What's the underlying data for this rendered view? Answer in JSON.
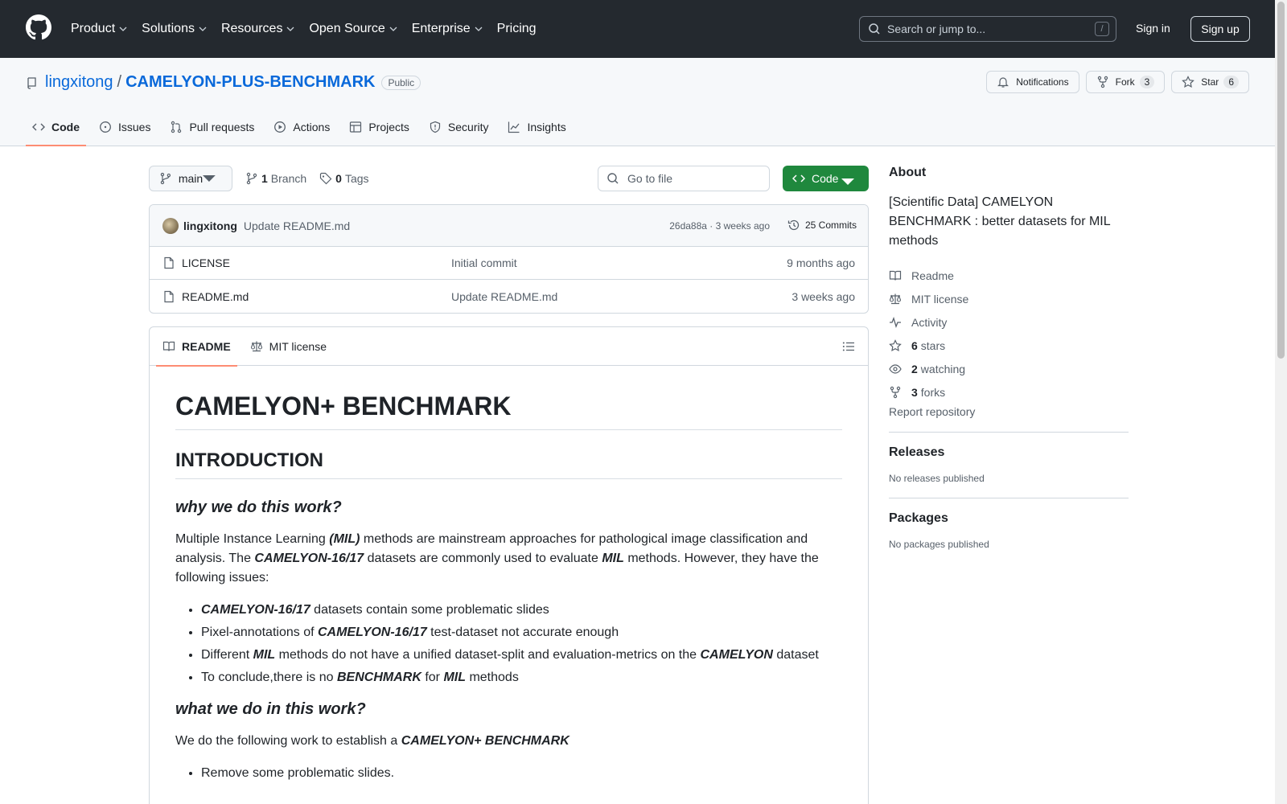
{
  "header": {
    "nav": [
      {
        "label": "Product",
        "dropdown": true
      },
      {
        "label": "Solutions",
        "dropdown": true
      },
      {
        "label": "Resources",
        "dropdown": true
      },
      {
        "label": "Open Source",
        "dropdown": true
      },
      {
        "label": "Enterprise",
        "dropdown": true
      },
      {
        "label": "Pricing",
        "dropdown": false
      }
    ],
    "search_placeholder": "Search or jump to...",
    "search_shortcut": "/",
    "sign_in": "Sign in",
    "sign_up": "Sign up"
  },
  "repo": {
    "owner": "lingxitong",
    "separator": "/",
    "name": "CAMELYON-PLUS-BENCHMARK",
    "visibility": "Public",
    "notifications_label": "Notifications",
    "fork_label": "Fork",
    "fork_count": "3",
    "star_label": "Star",
    "star_count": "6",
    "tabs": [
      "Code",
      "Issues",
      "Pull requests",
      "Actions",
      "Projects",
      "Security",
      "Insights"
    ]
  },
  "file_nav": {
    "branch": "main",
    "branch_count": "1",
    "branch_label": "Branch",
    "tag_count": "0",
    "tag_label": "Tags",
    "goto_placeholder": "Go to file",
    "code_button": "Code"
  },
  "commit": {
    "author": "lingxitong",
    "message": "Update README.md",
    "meta": "26da88a · 3 weeks ago",
    "count": "25 Commits"
  },
  "files": [
    {
      "name": "LICENSE",
      "commit": "Initial commit",
      "time": "9 months ago"
    },
    {
      "name": "README.md",
      "commit": "Update README.md",
      "time": "3 weeks ago"
    }
  ],
  "readme": {
    "tab_readme": "README",
    "tab_license": "MIT license",
    "h1": "CAMELYON+ BENCHMARK",
    "h2": "INTRODUCTION",
    "h3_why": "why we do this work?",
    "p1_a": "Multiple Instance Learning ",
    "p1_b": "(MIL)",
    "p1_c": " methods are mainstream approaches for pathological image classification and analysis. The ",
    "p1_d": "CAMELYON-16/17",
    "p1_e": " datasets are commonly used to evaluate ",
    "p1_f": "MIL",
    "p1_g": " methods. However, they have the following issues:",
    "li1_a": "CAMELYON-16/17",
    "li1_b": " datasets contain some problematic slides",
    "li2_a": "Pixel-annotations of ",
    "li2_b": "CAMELYON-16/17",
    "li2_c": " test-dataset not accurate enough",
    "li3_a": "Different ",
    "li3_b": "MIL",
    "li3_c": " methods do not have a unified dataset-split and evaluation-metrics on the ",
    "li3_d": "CAMELYON",
    "li3_e": " dataset",
    "li4_a": "To conclude,there is no ",
    "li4_b": "BENCHMARK",
    "li4_c": " for ",
    "li4_d": "MIL",
    "li4_e": " methods",
    "h3_what": "what we do in this work?",
    "p2_a": "We do the following work to establish a ",
    "p2_b": "CAMELYON+ BENCHMARK",
    "li5": "Remove some problematic slides."
  },
  "sidebar": {
    "about_title": "About",
    "description": "[Scientific Data] CAMELYON BENCHMARK : better datasets for MIL methods",
    "readme": "Readme",
    "license": "MIT license",
    "activity": "Activity",
    "stars_count": "6",
    "stars_label": "stars",
    "watching_count": "2",
    "watching_label": "watching",
    "forks_count": "3",
    "forks_label": "forks",
    "report": "Report repository",
    "releases_title": "Releases",
    "releases_empty": "No releases published",
    "packages_title": "Packages",
    "packages_empty": "No packages published"
  },
  "colors": {
    "header_bg": "#24292f",
    "link": "#0969da",
    "green": "#1f883d",
    "tab_underline": "#fd8c73"
  }
}
